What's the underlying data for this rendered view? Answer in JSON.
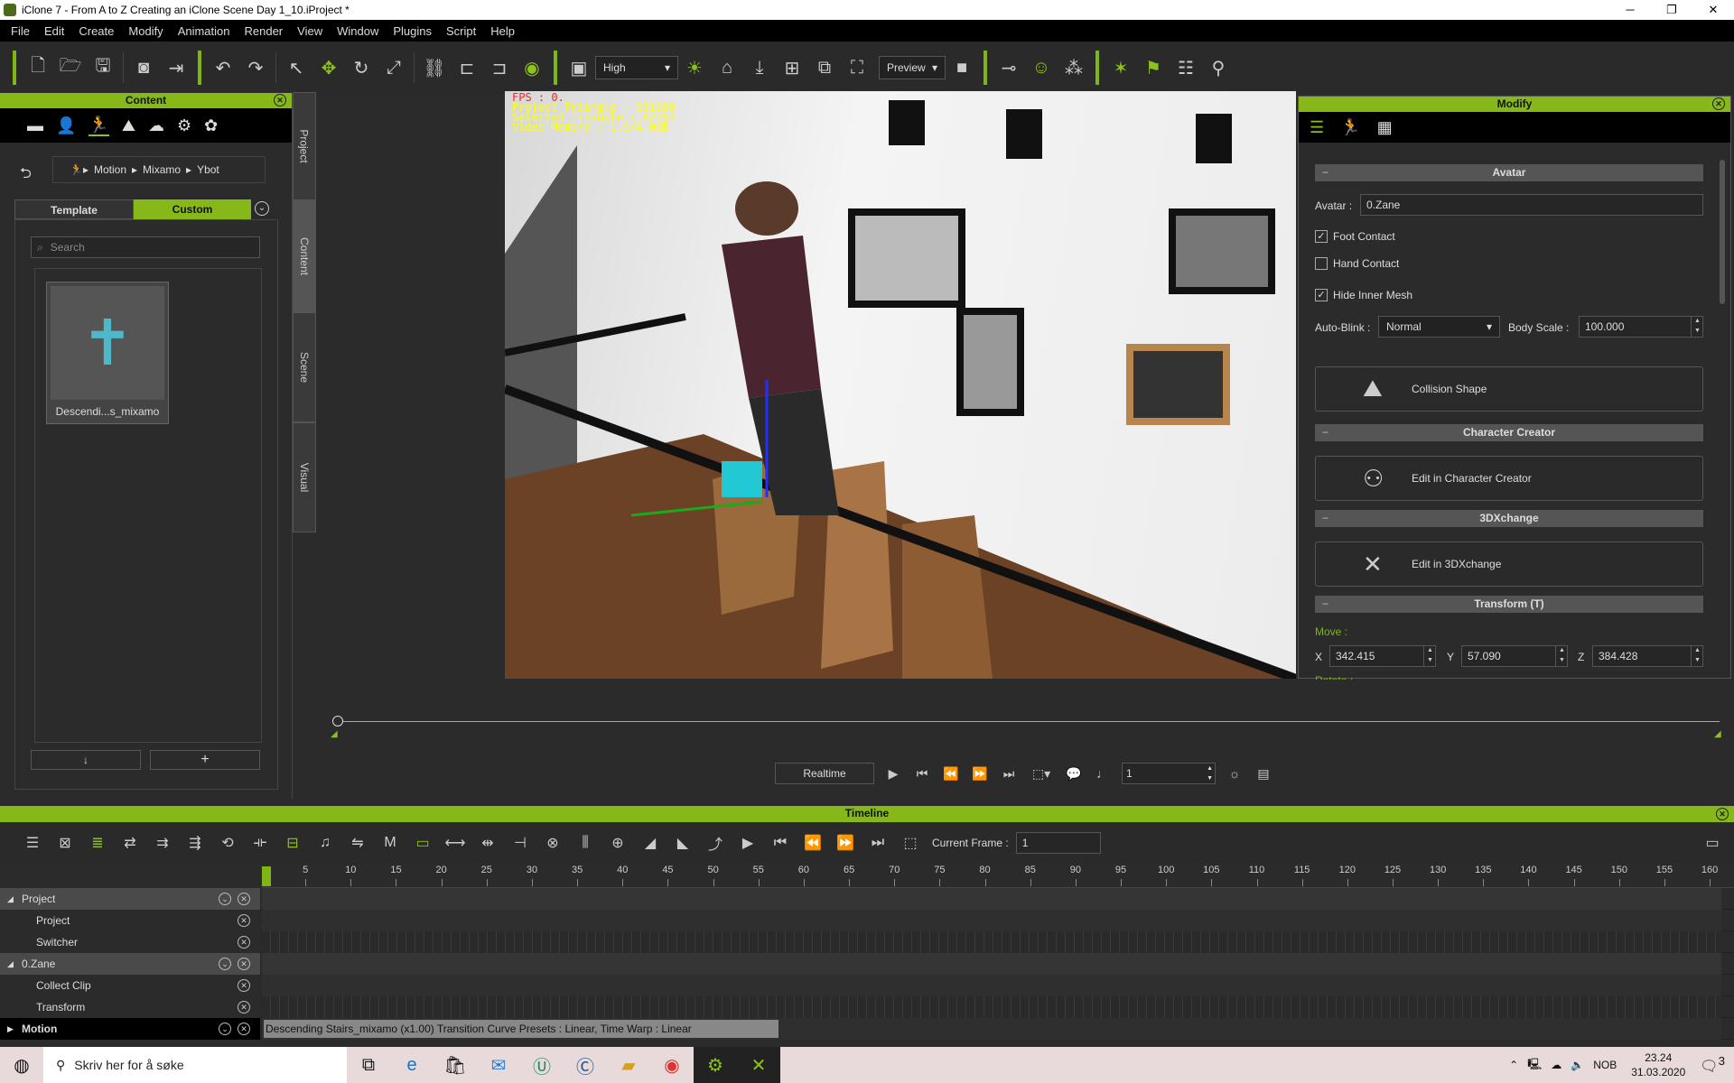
{
  "window": {
    "title": "iClone 7 - From A to Z Creating an iClone Scene Day 1_10.iProject *",
    "minimize": "─",
    "maximize": "❐",
    "close": "✕"
  },
  "menu": [
    "File",
    "Edit",
    "Create",
    "Modify",
    "Animation",
    "Render",
    "View",
    "Window",
    "Plugins",
    "Script",
    "Help"
  ],
  "toolbar": {
    "quality": "High",
    "preview": "Preview"
  },
  "content": {
    "title": "Content",
    "breadcrumb": [
      "Motion",
      "Mixamo",
      "Ybot"
    ],
    "tabs": [
      "Template",
      "Custom"
    ],
    "active_tab": "Custom",
    "search_placeholder": "Search",
    "items": [
      {
        "label": "Descendi...s_mixamo"
      }
    ],
    "down_btn": "↓",
    "add_btn": "+"
  },
  "side_tabs": [
    "Project",
    "Content",
    "Scene",
    "Visual"
  ],
  "viewport": {
    "fps": "FPS : 0.",
    "project_tri": "Project Triangle : 351660",
    "selected_tri": "Selected Triangle : 62753",
    "video_mem": "Video Memory : 1.0/4.0GB"
  },
  "modify": {
    "title": "Modify",
    "avatar_section": "Avatar",
    "avatar_label": "Avatar :",
    "avatar_value": "0.Zane",
    "foot_contact": {
      "label": "Foot Contact",
      "checked": true
    },
    "hand_contact": {
      "label": "Hand Contact",
      "checked": false
    },
    "hide_inner_mesh": {
      "label": "Hide Inner Mesh",
      "checked": true
    },
    "auto_blink_label": "Auto-Blink :",
    "auto_blink": "Normal",
    "body_scale_label": "Body Scale :",
    "body_scale": "100.000",
    "collision_shape": "Collision Shape",
    "cc_section": "Character Creator",
    "cc_btn": "Edit in Character Creator",
    "x3d_section": "3DXchange",
    "x3d_btn": "Edit in 3DXchange",
    "transform_section": "Transform  (T)",
    "move_label": "Move :",
    "x_label": "X",
    "x": "342.415",
    "y_label": "Y",
    "y": "57.090",
    "z_label": "Z",
    "z": "384.428",
    "rotate_label": "Rotate :"
  },
  "playback": {
    "mode": "Realtime",
    "frame": "1"
  },
  "timeline": {
    "title": "Timeline",
    "current_frame_label": "Current Frame :",
    "current_frame": "1",
    "ticks": [
      5,
      10,
      15,
      20,
      25,
      30,
      35,
      40,
      45,
      50,
      55,
      60,
      65,
      70,
      75,
      80,
      85,
      90,
      95,
      100,
      105,
      110,
      115,
      120,
      125,
      130,
      135,
      140,
      145,
      150,
      155,
      160
    ],
    "tracks": [
      {
        "name": "Project",
        "group": true
      },
      {
        "name": "Project",
        "group": false
      },
      {
        "name": "Switcher",
        "group": false
      },
      {
        "name": "0.Zane",
        "group": true
      },
      {
        "name": "Collect Clip",
        "group": false
      },
      {
        "name": "Transform",
        "group": false
      },
      {
        "name": "Motion",
        "group": false,
        "bold": true
      }
    ],
    "clip": "Descending Stairs_mixamo (x1.00) Transition Curve Presets : Linear, Time Warp : Linear"
  },
  "taskbar": {
    "search": "Skriv her for å søke",
    "lang": "NOB",
    "time": "23.24",
    "date": "31.03.2020",
    "notifications": "3"
  },
  "colors": {
    "accent": "#86b81a",
    "fps": "#ff2020",
    "stats": "#ffff00"
  }
}
